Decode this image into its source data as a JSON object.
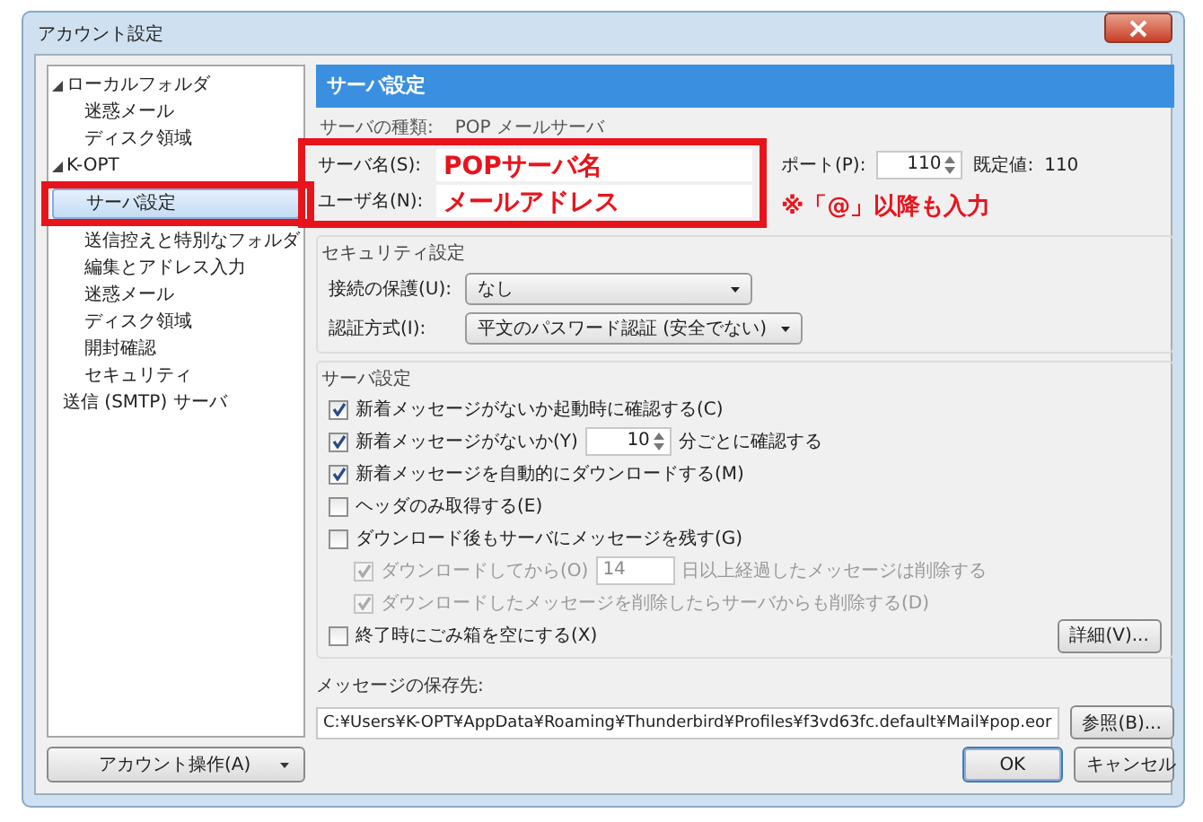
{
  "window": {
    "title": "アカウント設定"
  },
  "sidebar": {
    "items": [
      {
        "label": "ローカルフォルダ",
        "expanded": true,
        "selected": false,
        "highlighted": false,
        "children": [
          {
            "label": "迷惑メール",
            "selected": false,
            "highlighted": false
          },
          {
            "label": "ディスク領域",
            "selected": false,
            "highlighted": false
          }
        ]
      },
      {
        "label": "K-OPT",
        "expanded": true,
        "selected": false,
        "highlighted": false,
        "children": [
          {
            "label": "サーバ設定",
            "selected": true,
            "highlighted": true
          },
          {
            "label": "送信控えと特別なフォルダ",
            "selected": false,
            "highlighted": false
          },
          {
            "label": "編集とアドレス入力",
            "selected": false,
            "highlighted": false
          },
          {
            "label": "迷惑メール",
            "selected": false,
            "highlighted": false
          },
          {
            "label": "ディスク領域",
            "selected": false,
            "highlighted": false
          },
          {
            "label": "開封確認",
            "selected": false,
            "highlighted": false
          },
          {
            "label": "セキュリティ",
            "selected": false,
            "highlighted": false
          }
        ]
      },
      {
        "label": "送信 (SMTP) サーバ",
        "selected": false,
        "highlighted": false
      }
    ],
    "account_actions_button": "アカウント操作(A)"
  },
  "panel": {
    "header": "サーバ設定",
    "server_type": {
      "label": "サーバの種類:",
      "value": "POP メールサーバ"
    },
    "highlighted": true,
    "server_name": {
      "label": "サーバ名(S):",
      "value": "POPサーバ名"
    },
    "user_name": {
      "label": "ユーザ名(N):",
      "value": "メールアドレス"
    },
    "port": {
      "label": "ポート(P):",
      "value": "110"
    },
    "default": {
      "label": "既定値:",
      "value": "110"
    },
    "note": "※「@」以降も入力"
  },
  "security": {
    "title": "セキュリティ設定",
    "connection": {
      "label": "接続の保護(U):",
      "value": "なし"
    },
    "auth": {
      "label": "認証方式(I):",
      "value": "平文のパスワード認証 (安全でない)"
    }
  },
  "server_settings": {
    "title": "サーバ設定",
    "options": [
      {
        "label": "新着メッセージがないか起動時に確認する(C)",
        "checked": true,
        "disabled": false
      },
      {
        "label": "新着メッセージがないか(Y)",
        "checked": true,
        "disabled": false,
        "number": {
          "value": "10",
          "spinner": true
        },
        "suffix": "分ごとに確認する"
      },
      {
        "label": "新着メッセージを自動的にダウンロードする(M)",
        "checked": true,
        "disabled": false
      },
      {
        "label": "ヘッダのみ取得する(E)",
        "checked": false,
        "disabled": false
      },
      {
        "label": "ダウンロード後もサーバにメッセージを残す(G)",
        "checked": false,
        "disabled": false,
        "children": [
          {
            "label": "ダウンロードしてから(O)",
            "checked": true,
            "disabled": true,
            "number": {
              "value": "14",
              "spinner": false
            },
            "suffix": "日以上経過したメッセージは削除する"
          },
          {
            "label": "ダウンロードしたメッセージを削除したらサーバからも削除する(D)",
            "checked": true,
            "disabled": true
          }
        ]
      },
      {
        "label": "終了時にごみ箱を空にする(X)",
        "checked": false,
        "disabled": false,
        "button": "詳細(V)..."
      }
    ]
  },
  "storage": {
    "label": "メッセージの保存先:",
    "path": "C:¥Users¥K-OPT¥AppData¥Roaming¥Thunderbird¥Profiles¥f3vd63fc.default¥Mail¥pop.eor",
    "browse_button": "参照(B)..."
  },
  "buttons": [
    "OK",
    "キャンセル"
  ]
}
